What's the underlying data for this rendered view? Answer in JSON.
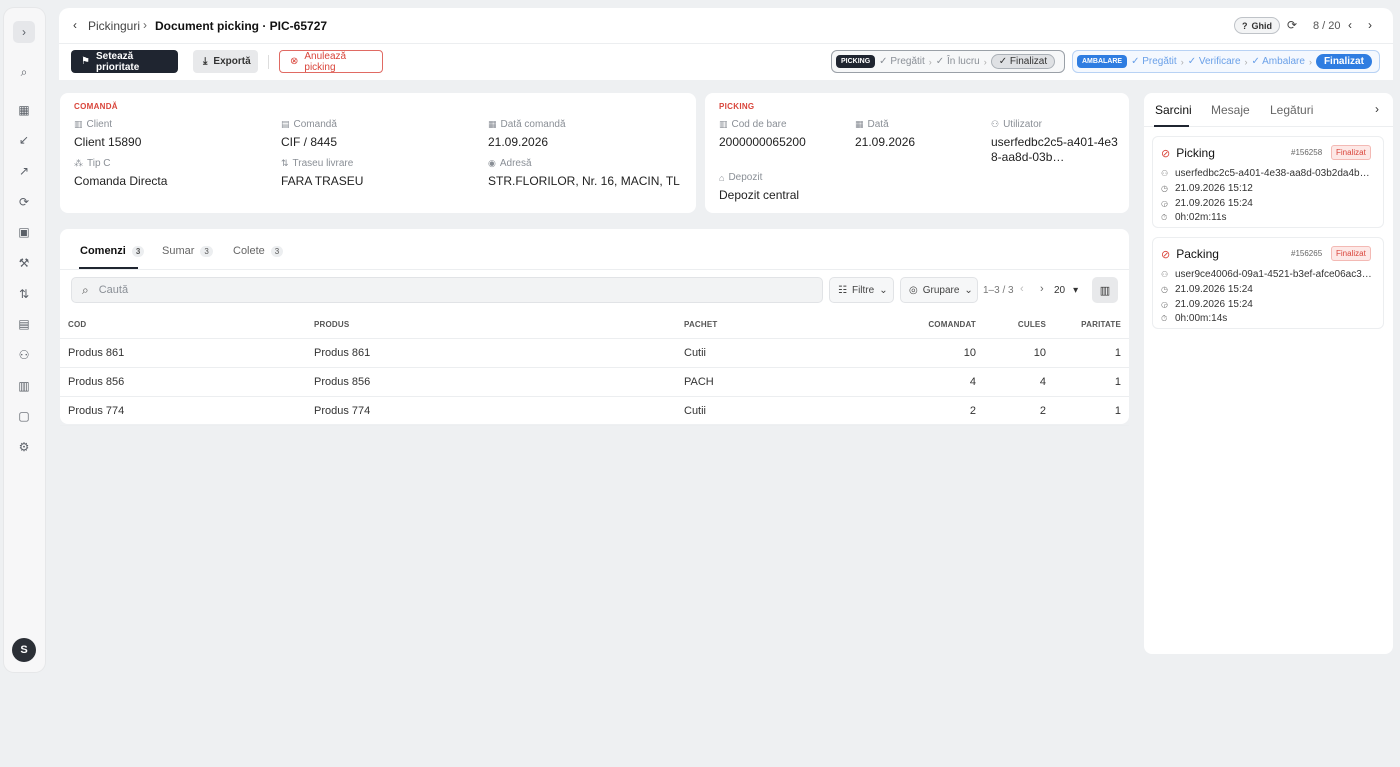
{
  "sidebar": {
    "toggle_icon": "chevron-right-icon",
    "items": [
      {
        "name": "search-icon",
        "glyph": "⌕"
      },
      {
        "name": "dashboard-icon",
        "glyph": "▦"
      },
      {
        "name": "inbound-icon",
        "glyph": "↙"
      },
      {
        "name": "outbound-icon",
        "glyph": "↗"
      },
      {
        "name": "transfer-icon",
        "glyph": "⟳"
      },
      {
        "name": "clipboard-icon",
        "glyph": "▣"
      },
      {
        "name": "forklift-icon",
        "glyph": "⚒"
      },
      {
        "name": "route-icon",
        "glyph": "⇅"
      },
      {
        "name": "cash-icon",
        "glyph": "▤"
      },
      {
        "name": "users-icon",
        "glyph": "⚇"
      },
      {
        "name": "book-icon",
        "glyph": "▥"
      },
      {
        "name": "file-icon",
        "glyph": "▢"
      },
      {
        "name": "settings-icon",
        "glyph": "⚙"
      }
    ],
    "avatar": "S"
  },
  "header": {
    "breadcrumb_parent": "Pickinguri",
    "breadcrumb_current": "Document picking · PIC-65727",
    "guide_label": "Ghid",
    "pager": "8 / 20"
  },
  "toolbar": {
    "priority_label": "Setează prioritate",
    "export_label": "Exportă",
    "cancel_label": "Anulează picking"
  },
  "status_picking": {
    "tag": "PICKING",
    "steps": [
      "✓ Pregătit",
      "✓ În lucru"
    ],
    "final": "✓ Finalizat"
  },
  "status_ambalare": {
    "tag": "AMBALARE",
    "steps": [
      "✓ Pregătit",
      "✓ Verificare",
      "✓ Ambalare"
    ],
    "final": "Finalizat"
  },
  "comanda": {
    "title": "COMANDĂ",
    "client_label": "Client",
    "client": "Client 15890",
    "comanda_label": "Comandă",
    "comanda": "CIF / 8445",
    "data_label": "Dată comandă",
    "data": "21.09.2026",
    "tip_label": "Tip C",
    "tip": "Comanda Directa",
    "traseu_label": "Traseu livrare",
    "traseu": "FARA TRASEU",
    "adresa_label": "Adresă",
    "adresa": "STR.FLORILOR, Nr. 16, MACIN, TL"
  },
  "picking": {
    "title": "PICKING",
    "cod_label": "Cod de bare",
    "cod": "2000000065200",
    "data_label": "Dată",
    "data": "21.09.2026",
    "user_label": "Utilizator",
    "user": "userfedbc2c5-a401-4e38-aa8d-03b…",
    "depozit_label": "Depozit",
    "depozit": "Depozit central"
  },
  "tabs": [
    {
      "label": "Comenzi",
      "count": "3"
    },
    {
      "label": "Sumar",
      "count": "3"
    },
    {
      "label": "Colete",
      "count": "3"
    }
  ],
  "search": {
    "placeholder": "Caută"
  },
  "filters": {
    "filter_label": "Filtre",
    "group_label": "Grupare",
    "range": "1–3 / 3",
    "per_page": "20"
  },
  "table": {
    "headers": [
      "COD",
      "PRODUS",
      "PACHET",
      "COMANDAT",
      "CULES",
      "PARITATE"
    ],
    "rows": [
      [
        "Produs 861",
        "Produs 861",
        "Cutii",
        "10",
        "10",
        "1"
      ],
      [
        "Produs 856",
        "Produs 856",
        "PACH",
        "4",
        "4",
        "1"
      ],
      [
        "Produs 774",
        "Produs 774",
        "Cutii",
        "2",
        "2",
        "1"
      ]
    ]
  },
  "side_panel": {
    "tabs": [
      "Sarcini",
      "Mesaje",
      "Legături"
    ],
    "tasks": [
      {
        "title": "Picking",
        "id": "#156258",
        "status": "Finalizat",
        "user": "userfedbc2c5-a401-4e38-aa8d-03b2da4b…",
        "start": "21.09.2026 15:12",
        "end": "21.09.2026 15:24",
        "duration": "0h:02m:11s"
      },
      {
        "title": "Packing",
        "id": "#156265",
        "status": "Finalizat",
        "user": "user9ce4006d-09a1-4521-b3ef-afce06ac3…",
        "start": "21.09.2026 15:24",
        "end": "21.09.2026 15:24",
        "duration": "0h:00m:14s"
      }
    ]
  },
  "colors": {
    "accent_red": "#d9453b",
    "dark": "#1f2530",
    "blue": "#2f7de1"
  }
}
